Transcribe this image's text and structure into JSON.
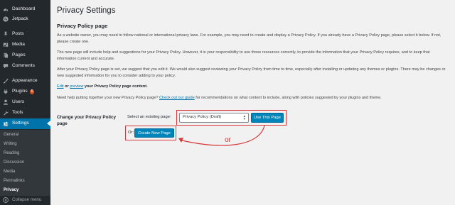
{
  "sidebar": {
    "items": [
      {
        "label": "Dashboard",
        "icon": "dashboard-icon"
      },
      {
        "label": "Jetpack",
        "icon": "jetpack-icon"
      },
      {
        "label": "Posts",
        "icon": "pin-icon"
      },
      {
        "label": "Media",
        "icon": "media-icon"
      },
      {
        "label": "Pages",
        "icon": "pages-icon"
      },
      {
        "label": "Comments",
        "icon": "comment-icon"
      },
      {
        "label": "Appearance",
        "icon": "brush-icon"
      },
      {
        "label": "Plugins",
        "icon": "plugin-icon",
        "badge": "6"
      },
      {
        "label": "Users",
        "icon": "user-icon"
      },
      {
        "label": "Tools",
        "icon": "wrench-icon"
      },
      {
        "label": "Settings",
        "icon": "settings-icon"
      }
    ],
    "submenu": [
      "General",
      "Writing",
      "Reading",
      "Discussion",
      "Media",
      "Permalinks",
      "Privacy"
    ],
    "collapse_label": "Collapse menu",
    "active_color": "#0073aa"
  },
  "main": {
    "title": "Privacy Settings",
    "section_title": "Privacy Policy page",
    "para1": "As a website owner, you may need to follow national or international privacy laws. For example, you may need to create and display a Privacy Policy. If you already have a Privacy Policy page, please select it below. If not, please create one.",
    "para2": "The new page will include help and suggestions for your Privacy Policy. However, it is your responsibility to use those resources correctly, to provide the information that your Privacy Policy requires, and to keep that information current and accurate.",
    "para3": "After your Privacy Policy page is set, we suggest that you edit it. We would also suggest reviewing your Privacy Policy from time to time, especially after installing or updating any themes or plugins. There may be changes or new suggested information for you to consider adding to your policy.",
    "edit_link": "Edit",
    "or_word": "or",
    "preview_link": "preview",
    "edit_suffix": "your Privacy Policy page content.",
    "help_prefix": "Need help putting together your new Privacy Policy page?",
    "help_link": "Check out our guide",
    "help_suffix": "for recommendations on what content to include, along with policies suggested by your plugins and theme.",
    "row_label": "Change your Privacy Policy page",
    "select_label": "Select an existing page:",
    "select_value": "Privacy Policy (Draft)",
    "use_button": "Use This Page",
    "or_label": "Or:",
    "create_button": "Create New Page",
    "annotation_or": "or",
    "annotation_color": "#d63638"
  }
}
